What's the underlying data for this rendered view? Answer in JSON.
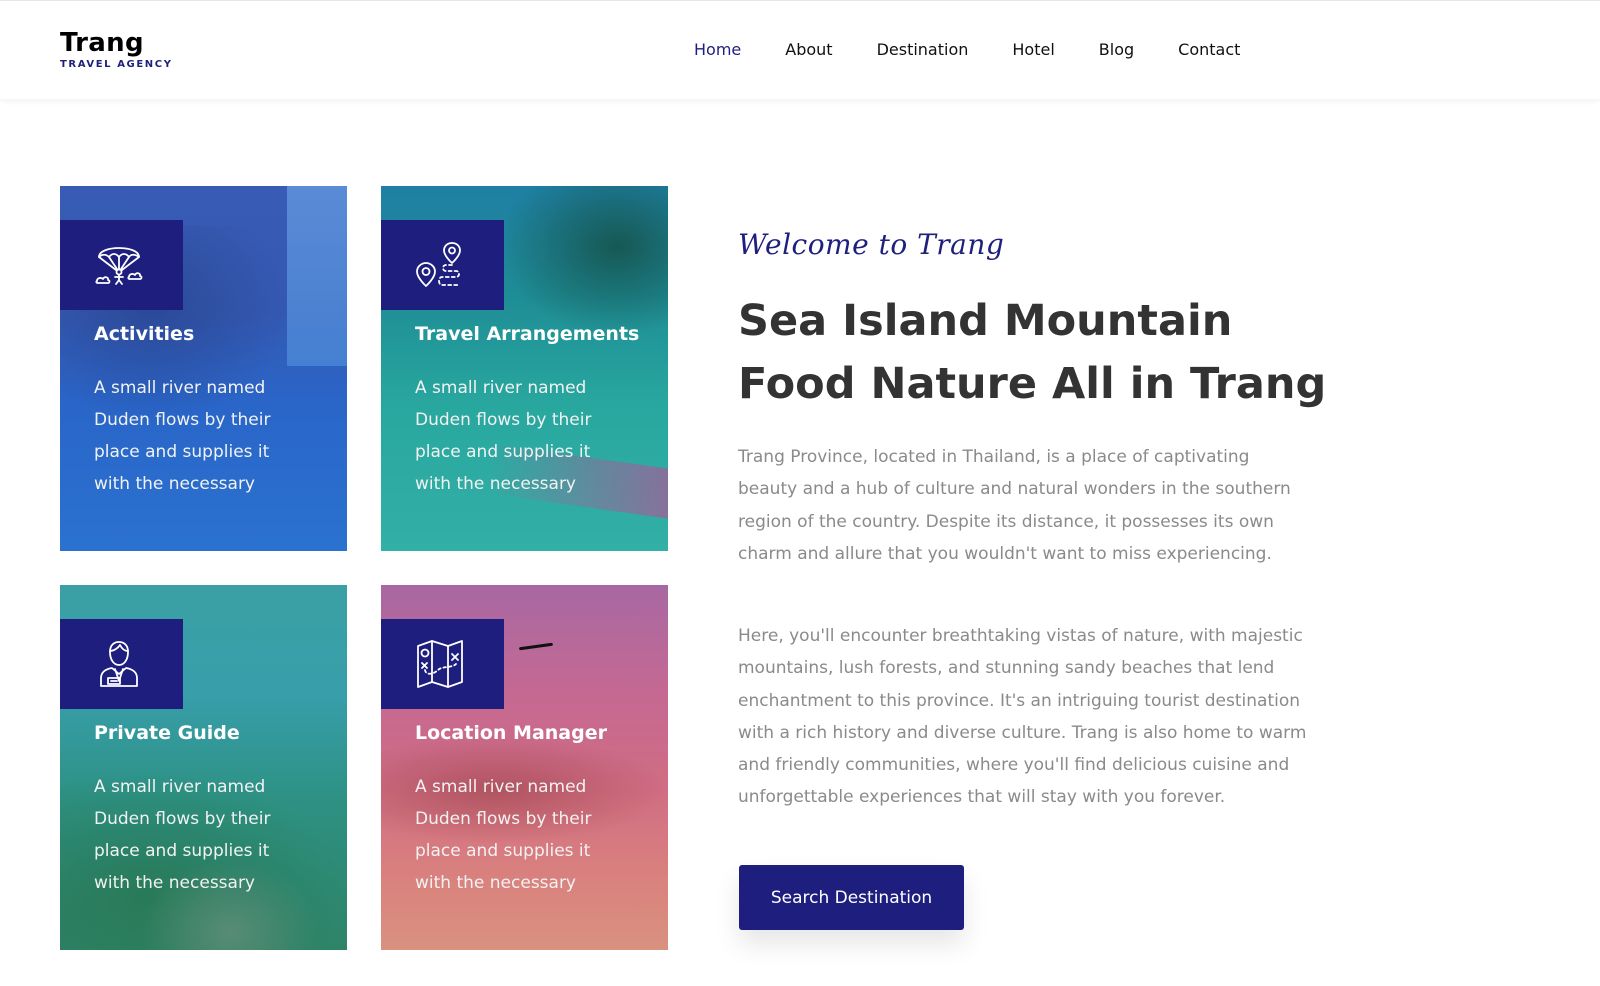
{
  "brand": {
    "title": "Trang",
    "subtitle": "TRAVEL AGENCY"
  },
  "nav": {
    "items": [
      {
        "label": "Home",
        "active": true
      },
      {
        "label": "About",
        "active": false
      },
      {
        "label": "Destination",
        "active": false
      },
      {
        "label": "Hotel",
        "active": false
      },
      {
        "label": "Blog",
        "active": false
      },
      {
        "label": "Contact",
        "active": false
      }
    ]
  },
  "services": [
    {
      "title": "Activities",
      "text": "A small river named Duden flows by their place and supplies it with the necessary",
      "icon": "paragliding-icon"
    },
    {
      "title": "Travel Arrangements",
      "text": "A small river named Duden flows by their place and supplies it with the necessary",
      "icon": "route-map-pin-icon"
    },
    {
      "title": "Private Guide",
      "text": "A small river named Duden flows by their place and supplies it with the necessary",
      "icon": "tour-guide-icon"
    },
    {
      "title": "Location Manager",
      "text": "A small river named Duden flows by their place and supplies it with the necessary",
      "icon": "folded-map-icon"
    }
  ],
  "intro": {
    "welcome": "Welcome to Trang",
    "headline": "Sea Island Mountain Food Nature All in Trang",
    "paragraph1": "Trang Province, located in Thailand, is a place of captivating beauty and a hub of culture and natural wonders in the southern region of the country. Despite its distance, it possesses its own charm and allure that you wouldn't want to miss experiencing.",
    "paragraph2": "Here, you'll encounter breathtaking vistas of nature, with majestic mountains, lush forests, and stunning sandy beaches that lend enchantment to this province. It's an intriguing tourist destination with a rich history and diverse culture. Trang is also home to warm and friendly communities, where you'll find delicious cuisine and unforgettable experiences that will stay with you forever.",
    "button_label": "Search Destination"
  },
  "colors": {
    "primary": "#1e1e7e",
    "heading": "#333333",
    "body_text": "#8a8a8a"
  }
}
